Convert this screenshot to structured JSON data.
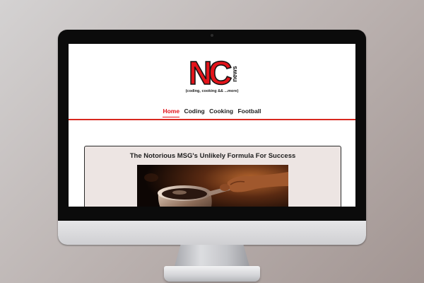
{
  "site": {
    "logo_letters": "NC",
    "logo_word": "news",
    "tagline": "(coding, cooking && ...more)"
  },
  "nav": {
    "items": [
      {
        "label": "Home",
        "active": true
      },
      {
        "label": "Coding",
        "active": false
      },
      {
        "label": "Cooking",
        "active": false
      },
      {
        "label": "Football",
        "active": false
      }
    ]
  },
  "article": {
    "title": "The Notorious MSG's Unlikely Formula For Success",
    "image": "cooking-pot-photo"
  },
  "colors": {
    "accent": "#e3141b",
    "card_bg": "#ede5e3",
    "background": "#b9b0ae"
  }
}
